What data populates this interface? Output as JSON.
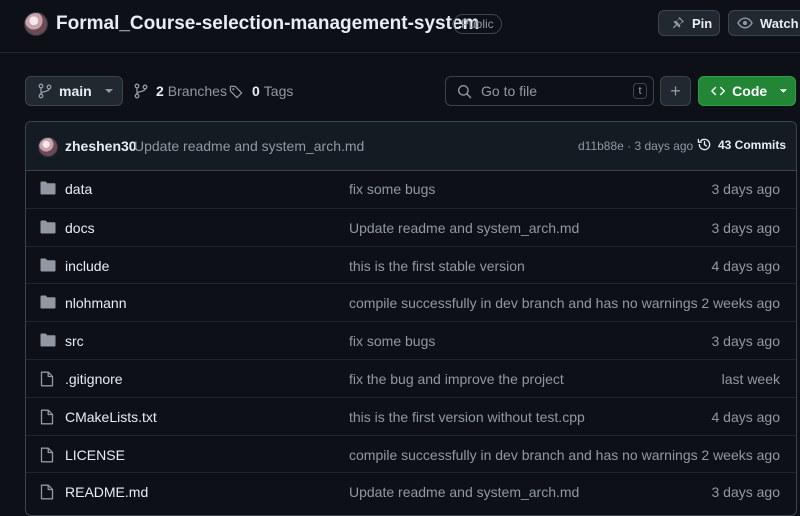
{
  "repo": {
    "name": "Formal_Course-selection-management-system",
    "visibility": "Public",
    "pin_label": "Pin",
    "watch_label": "Watch"
  },
  "toolbar": {
    "branch": "main",
    "branches_count": "2",
    "branches_label": "Branches",
    "tags_count": "0",
    "tags_label": "Tags",
    "search_placeholder": "Go to file",
    "search_shortcut": "t",
    "add_label": "+",
    "code_label": "Code"
  },
  "latest_commit": {
    "author": "zheshen30",
    "message": "Update readme and system_arch.md",
    "hash_time": "d11b88e · 3 days ago",
    "commits_label": "43 Commits"
  },
  "files": [
    {
      "name": "data",
      "type": "folder",
      "message": "fix some bugs",
      "time": "3 days ago"
    },
    {
      "name": "docs",
      "type": "folder",
      "message": "Update readme and system_arch.md",
      "time": "3 days ago"
    },
    {
      "name": "include",
      "type": "folder",
      "message": "this is the first stable version",
      "time": "4 days ago"
    },
    {
      "name": "nlohmann",
      "type": "folder",
      "message": "compile successfully in dev branch and has no warnings",
      "time": "2 weeks ago"
    },
    {
      "name": "src",
      "type": "folder",
      "message": "fix some bugs",
      "time": "3 days ago"
    },
    {
      "name": ".gitignore",
      "type": "file",
      "message": "fix the bug and improve the project",
      "time": "last week"
    },
    {
      "name": "CMakeLists.txt",
      "type": "file",
      "message": "this is the first version without test.cpp",
      "time": "4 days ago"
    },
    {
      "name": "LICENSE",
      "type": "file",
      "message": "compile successfully in dev branch and has no warnings",
      "time": "2 weeks ago"
    },
    {
      "name": "README.md",
      "type": "file",
      "message": "Update readme and system_arch.md",
      "time": "3 days ago"
    }
  ],
  "colors": {
    "background": "#0d1117",
    "border": "#3d444d",
    "text": "#e6edf3",
    "muted": "#9198a1",
    "code_button": "#238636",
    "folder_icon": "#9198a1"
  }
}
